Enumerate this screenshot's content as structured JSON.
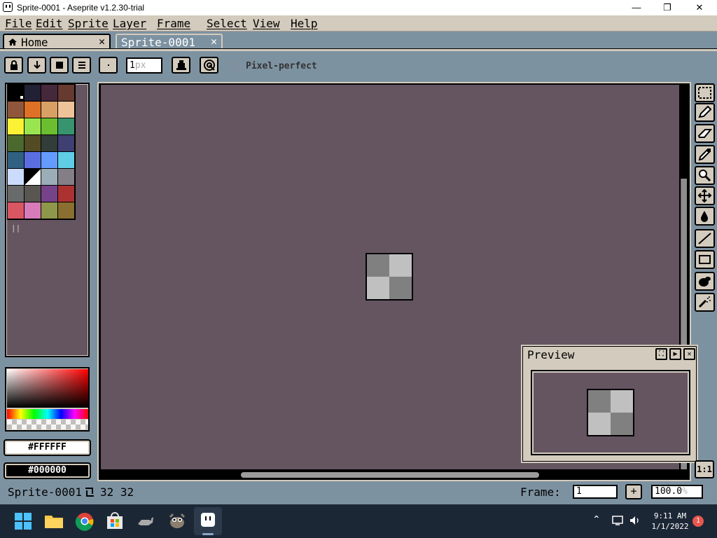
{
  "window": {
    "title": "Sprite-0001 - Aseprite v1.2.30-trial",
    "minimize": "—",
    "maximize": "❐",
    "close": "✕"
  },
  "menu": [
    "File",
    "Edit",
    "Sprite",
    "Layer",
    "Frame",
    "Select",
    "View",
    "Help"
  ],
  "tabs": [
    {
      "label": "Home",
      "close": "✕",
      "active": false
    },
    {
      "label": "Sprite-0001",
      "close": "✕",
      "active": true
    }
  ],
  "context_bar": {
    "brush_size": "1",
    "brush_size_unit": "px",
    "pixel_perfect_label": "Pixel-perfect",
    "pixel_perfect_checked": false
  },
  "palette": [
    "#000000",
    "#222034",
    "#45283c",
    "#663931",
    "#8f563b",
    "#df7126",
    "#d9a066",
    "#eec39a",
    "#fbf236",
    "#99e550",
    "#6abe30",
    "#37946e",
    "#4b692f",
    "#524b24",
    "#323c39",
    "#3f3f74",
    "#306082",
    "#5b6ee1",
    "#639bff",
    "#5fcde4",
    "#cbdbfc",
    "#ffffff",
    "#9badb7",
    "#847e87",
    "#696a6a",
    "#595652",
    "#76428a",
    "#ac3232",
    "#d95763",
    "#d77bba",
    "#8f974a",
    "#8a6f30"
  ],
  "colors": {
    "foreground": "#FFFFFF",
    "background": "#000000",
    "canvas_bg": "#655561",
    "ui_face": "#d3cbbd",
    "ui_back": "#7d92a1"
  },
  "tools": [
    "rectangular-marquee",
    "pencil",
    "eraser",
    "eyedropper",
    "zoom",
    "move",
    "paint-bucket",
    "line",
    "rectangle",
    "blur",
    "spray"
  ],
  "preview": {
    "title": "Preview",
    "zoom_label": "1:1"
  },
  "status_bar": {
    "sprite_name": "Sprite-0001",
    "dimensions": "32 32",
    "frame_label": "Frame:",
    "frame_value": "1",
    "add_frame": "+",
    "zoom_value": "100.0",
    "zoom_unit": "%"
  },
  "taskbar": {
    "time": "9:11 AM",
    "date": "1/1/2022",
    "notification_count": "1",
    "apps": [
      "start",
      "file-explorer",
      "chrome",
      "microsoft-store",
      "app-cat",
      "gimp",
      "aseprite"
    ]
  }
}
